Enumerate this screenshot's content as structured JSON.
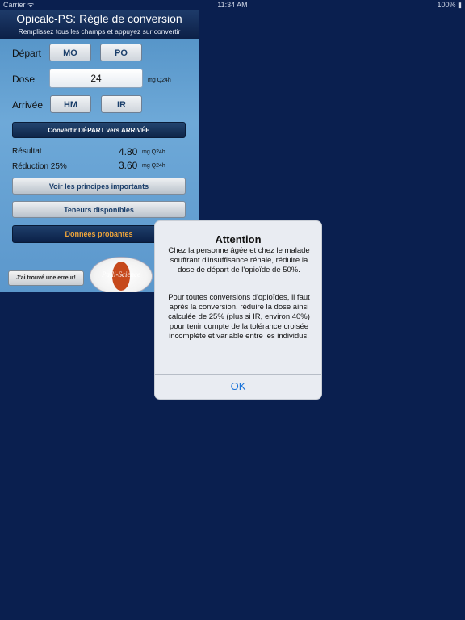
{
  "statusbar": {
    "carrier": "Carrier ᯤ",
    "time": "11:34 AM",
    "battery": "100% ▮"
  },
  "app": {
    "title": "Opicalc-PS: Règle de conversion",
    "subtitle": "Remplissez tous les champs et appuyez sur convertir"
  },
  "form": {
    "depart_label": "Départ",
    "depart_options": [
      "MO",
      "PO"
    ],
    "dose_label": "Dose",
    "dose_value": "24",
    "dose_unit": "mg Q24h",
    "arrivee_label": "Arrivée",
    "arrivee_options": [
      "HM",
      "IR"
    ]
  },
  "convert_button": "Convertir DÉPART vers ARRIVÉE",
  "results": {
    "resultat_label": "Résultat",
    "resultat_value": "4.80",
    "resultat_unit": "mg Q24h",
    "reduction_label": "Réduction 25%",
    "reduction_value": "3.60",
    "reduction_unit": "mg Q24h"
  },
  "buttons": {
    "principes": "Voir les principes importants",
    "teneurs": "Teneurs disponibles",
    "donnees": "Données probantes",
    "erreur": "J'ai trouvé une erreur!"
  },
  "logo": {
    "text": "Palli-Science"
  },
  "alert": {
    "title": "Attention",
    "paragraph1": "Chez la personne âgée et chez  le malade souffrant d'insuffisance rénale, réduire la dose de départ de l'opioïde de 50%.",
    "paragraph2": "Pour toutes conversions d'opioïdes, il faut après la conversion, réduire la dose ainsi calculée de 25% (plus si IR, environ 40%) pour  tenir compte de la tolérance croisée incomplète et variable entre les individus.",
    "ok": "OK"
  },
  "colors": {
    "background": "#0a1f4f",
    "accent_orange": "#f0a53a",
    "link_blue": "#1a73d9"
  }
}
